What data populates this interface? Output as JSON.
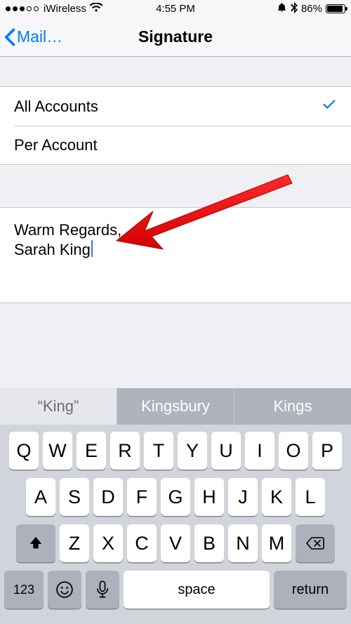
{
  "status": {
    "carrier": "iWireless",
    "time": "4:55 PM",
    "battery_pct": "86%"
  },
  "nav": {
    "back_label": "Mail…",
    "title": "Signature"
  },
  "options": {
    "all_accounts": "All Accounts",
    "per_account": "Per Account",
    "selected": "all_accounts"
  },
  "signature": {
    "line1": "Warm Regards,",
    "line2": "Sarah King"
  },
  "suggestions": {
    "s1": "“King”",
    "s2": "Kingsbury",
    "s3": "Kings"
  },
  "keyboard": {
    "row1": [
      "Q",
      "W",
      "E",
      "R",
      "T",
      "Y",
      "U",
      "I",
      "O",
      "P"
    ],
    "row2": [
      "A",
      "S",
      "D",
      "F",
      "G",
      "H",
      "J",
      "K",
      "L"
    ],
    "row3": [
      "Z",
      "X",
      "C",
      "V",
      "B",
      "N",
      "M"
    ],
    "numeric_label": "123",
    "space_label": "space",
    "return_label": "return"
  }
}
